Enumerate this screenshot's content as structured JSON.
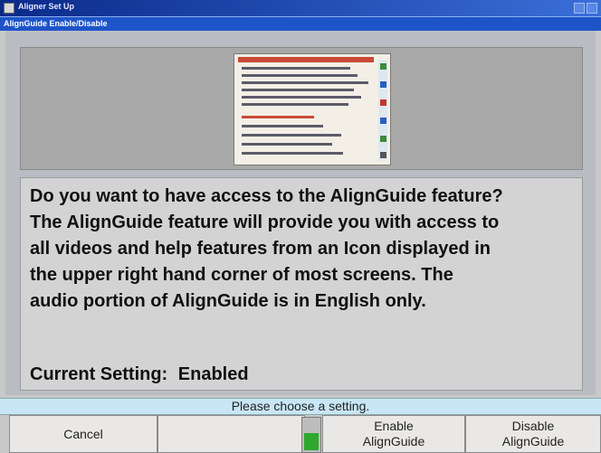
{
  "window": {
    "title": "Aligner Set Up",
    "subtitle": "AlignGuide Enable/Disable"
  },
  "preview": {
    "thumbnail_lines": [
      "AlignGuide Contents",
      "Installing the Aligner",
      "Principles of Alignment",
      "Preparing for a Wheel Alignment",
      "Compensating the Sensors",
      "Specifications and Measurements",
      "Performing Adjustments",
      "Troubleshooting",
      "Related Videos"
    ]
  },
  "message": {
    "text": "Do you want to have access to the AlignGuide feature?\nThe AlignGuide feature will provide you with access to\nall videos and help features from an Icon displayed in\nthe upper right hand corner of most screens.  The\naudio portion of AlignGuide is in English only.",
    "current_label": "Current Setting:",
    "current_value": "Enabled"
  },
  "status": {
    "prompt": "Please choose a setting."
  },
  "softkeys": {
    "cancel": "Cancel",
    "blank": "",
    "enable": "Enable AlignGuide",
    "disable": "Disable AlignGuide",
    "gauge_level": 0.55
  },
  "colors": {
    "title_bar": "#0a2a8a",
    "status_bar": "#c8e6f5",
    "gauge": "#2fa82f"
  }
}
